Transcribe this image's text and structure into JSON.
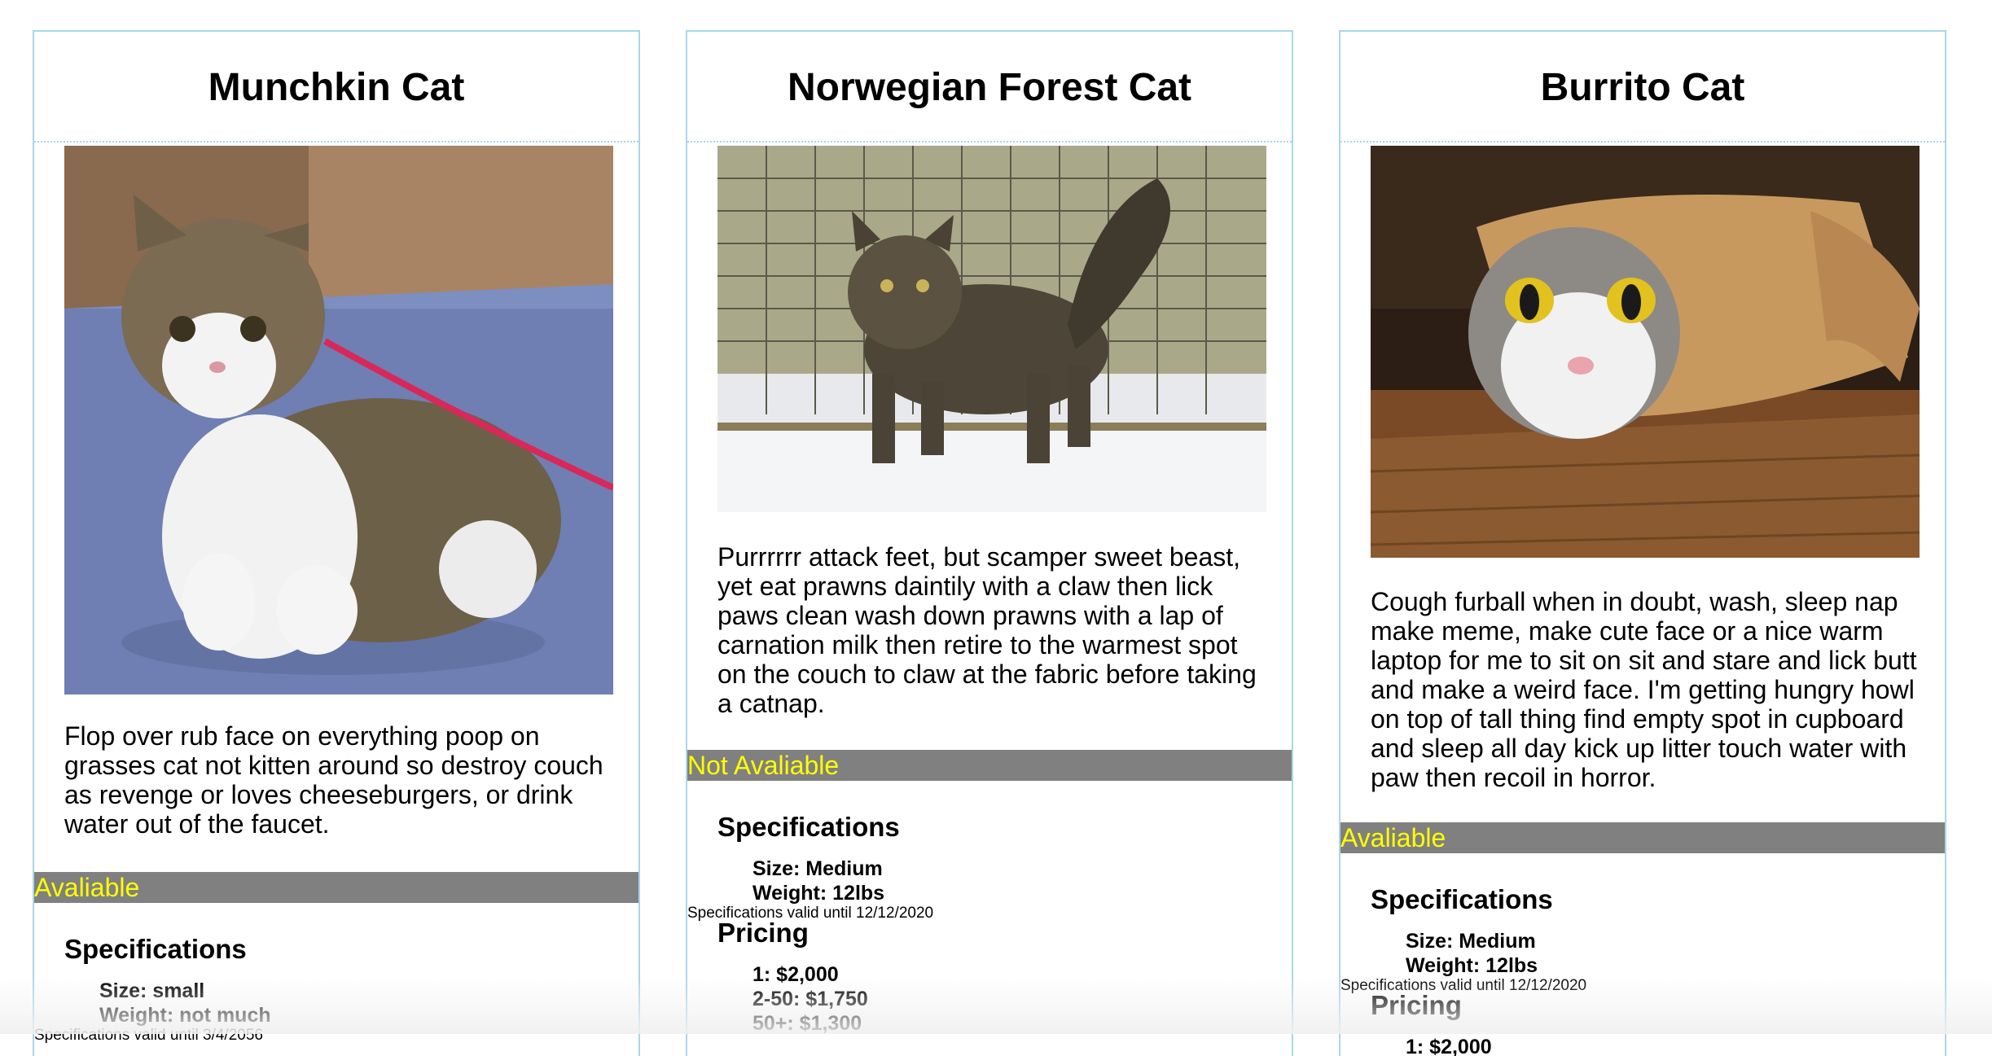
{
  "cards": [
    {
      "title": "Munchkin Cat",
      "image_alt": "munchkin-cat-photo",
      "description": "Flop over rub face on everything poop on grasses cat not kitten around so destroy couch as revenge or loves cheeseburgers, or drink water out of the faucet.",
      "availability": "Avaliable",
      "specs_heading": "Specifications",
      "specs": [
        "Size: small",
        "Weight: not much"
      ],
      "valid_note": "Specifications valid until 3/4/2056"
    },
    {
      "title": "Norwegian Forest Cat",
      "image_alt": "norwegian-forest-cat-photo",
      "description": "Purrrrrr attack feet, but scamper sweet beast, yet eat prawns daintily with a claw then lick paws clean wash down prawns with a lap of carnation milk then retire to the warmest spot on the couch to claw at the fabric before taking a catnap.",
      "availability": "Not Avaliable",
      "specs_heading": "Specifications",
      "specs": [
        "Size: Medium",
        "Weight: 12lbs"
      ],
      "valid_note": "Specifications valid until 12/12/2020",
      "pricing_heading": "Pricing",
      "pricing": [
        "1: $2,000",
        "2-50: $1,750",
        "50+: $1,300"
      ]
    },
    {
      "title": "Burrito Cat",
      "image_alt": "burrito-cat-photo",
      "description": "Cough furball when in doubt, wash, sleep nap make meme, make cute face or a nice warm laptop for me to sit on sit and stare and lick butt and make a weird face. I'm getting hungry howl on top of tall thing find empty spot in cupboard and sleep all day kick up litter touch water with paw then recoil in horror.",
      "availability": "Avaliable",
      "specs_heading": "Specifications",
      "specs": [
        "Size: Medium",
        "Weight: 12lbs"
      ],
      "valid_note": "Specifications valid until 12/12/2020",
      "pricing_heading": "Pricing",
      "pricing": [
        "1: $2,000"
      ]
    }
  ],
  "colors": {
    "border": "#a9d6ec",
    "availability_bg": "#808080",
    "availability_text": "#ffff00"
  }
}
